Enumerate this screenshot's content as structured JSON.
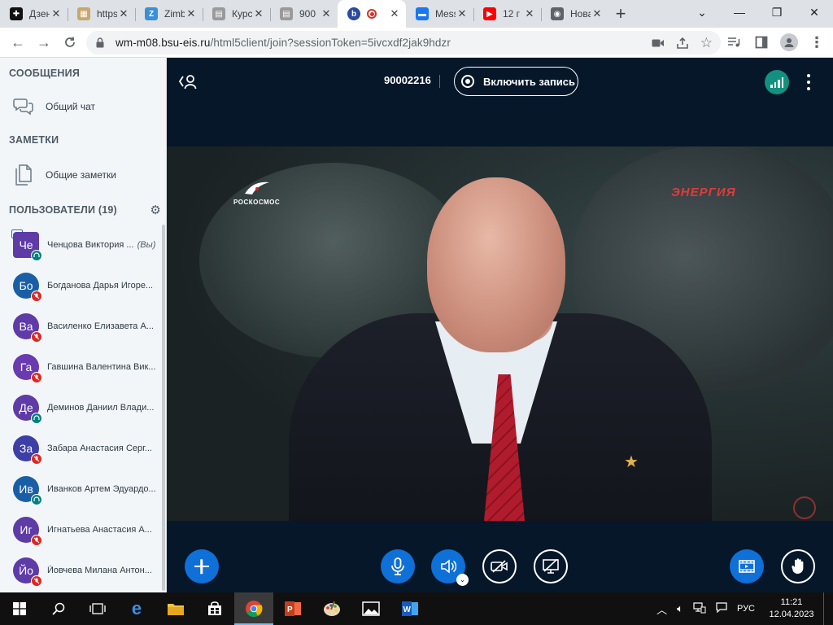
{
  "browser": {
    "tabs": [
      {
        "title": "Дзен",
        "favicon_color": "#111111",
        "favicon": "plus"
      },
      {
        "title": "https://",
        "favicon_color": "#c8a86a",
        "favicon": "grid"
      },
      {
        "title": "Zimbra",
        "favicon_color": "#3b8fd6",
        "favicon": "Z"
      },
      {
        "title": "Курс",
        "favicon_color": "#9a9a9a",
        "favicon": "doc"
      },
      {
        "title": "900",
        "favicon_color": "#9a9a9a",
        "favicon": "doc"
      },
      {
        "title": "",
        "favicon_color": "#2b4aa0",
        "favicon": "b",
        "active": true
      },
      {
        "title": "Messenger",
        "favicon_color": "#1877f2",
        "favicon": "chat"
      },
      {
        "title": "12 г",
        "favicon_color": "#ff0000",
        "favicon": "play"
      },
      {
        "title": "Новая в",
        "favicon_color": "#5f6368",
        "favicon": "chrome"
      }
    ],
    "url_host": "wm-m08.bsu-eis.ru",
    "url_path": "/html5client/join?sessionToken=5ivcxdf2jak9hdzr"
  },
  "sidebar": {
    "messages_header": "СООБЩЕНИЯ",
    "public_chat": "Общий чат",
    "notes_header": "ЗАМЕТКИ",
    "shared_notes": "Общие заметки",
    "users_header": "ПОЛЬЗОВАТЕЛИ (19)",
    "you_label": "(Вы)",
    "users": [
      {
        "initials": "Че",
        "name": "Ченцова Виктория ...",
        "color": "#5e3ba6",
        "status": "green",
        "me": true
      },
      {
        "initials": "Бо",
        "name": "Богданова Дарья Игоре...",
        "color": "#1a5fa6",
        "status": "red"
      },
      {
        "initials": "Ва",
        "name": "Василенко Елизавета А...",
        "color": "#5e3ba6",
        "status": "red"
      },
      {
        "initials": "Га",
        "name": "Гавшина Валентина Вик...",
        "color": "#6a3ab0",
        "status": "red"
      },
      {
        "initials": "Де",
        "name": "Деминов Даниил Влади...",
        "color": "#5e3ba6",
        "status": "green"
      },
      {
        "initials": "За",
        "name": "Забара Анастасия Серг...",
        "color": "#3d3ea6",
        "status": "red"
      },
      {
        "initials": "Ив",
        "name": "Иванков Артем Эдуардо...",
        "color": "#1a5fa6",
        "status": "green"
      },
      {
        "initials": "Иг",
        "name": "Игнатьева Анастасия А...",
        "color": "#5e3ba6",
        "status": "red"
      },
      {
        "initials": "Йо",
        "name": "Йовчева Милана Антон...",
        "color": "#5e3ba6",
        "status": "red"
      }
    ]
  },
  "meeting": {
    "id": "90002216",
    "record_label": "Включить запись",
    "video_logo_left": "РОСКОСМОС",
    "video_logo_right": "ЭНЕРГИЯ"
  },
  "taskbar": {
    "language": "РУС",
    "time": "11:21",
    "date": "12.04.2023"
  }
}
